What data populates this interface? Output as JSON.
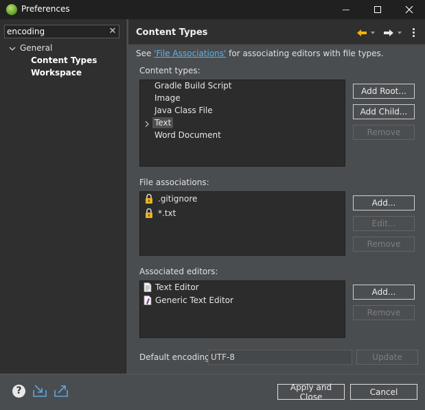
{
  "window": {
    "title": "Preferences"
  },
  "sidebar": {
    "filter_value": "encoding",
    "tree": {
      "general": "General",
      "content_types": "Content Types",
      "workspace": "Workspace"
    }
  },
  "page": {
    "title": "Content Types",
    "see_prefix": "See",
    "see_link": "'File Associations'",
    "see_suffix": "for associating editors with file types.",
    "content_types_label": "Content types:",
    "content_types": [
      "Gradle Build Script",
      "Image",
      "Java Class File",
      "Text",
      "Word Document"
    ],
    "selected_content_type": "Text",
    "file_associations_label": "File associations:",
    "file_associations": [
      ".gitignore",
      "*.txt"
    ],
    "associated_editors_label": "Associated editors:",
    "associated_editors": [
      "Text Editor",
      "Generic Text Editor"
    ],
    "default_encoding_label": "Default encoding:",
    "default_encoding_value": "UTF-8"
  },
  "buttons": {
    "add_root": "Add Root...",
    "add_child": "Add Child...",
    "ct_remove": "Remove",
    "fa_add": "Add...",
    "fa_edit": "Edit...",
    "fa_remove": "Remove",
    "ae_add": "Add...",
    "ae_remove": "Remove",
    "update": "Update",
    "apply_close": "Apply and Close",
    "cancel": "Cancel"
  },
  "icons": {
    "app": "spring-leaf-icon",
    "clear": "clear-icon",
    "back": "back-arrow-icon",
    "forward": "forward-arrow-icon",
    "menu": "view-menu-icon",
    "lock": "lock-icon",
    "text_editor": "text-file-icon",
    "generic_editor": "generic-editor-icon",
    "help": "help-icon",
    "import": "import-icon",
    "export": "export-icon"
  },
  "colors": {
    "link": "#5fb3e8",
    "accent_arrow": "#f2b400",
    "lock": "#e6b422"
  }
}
